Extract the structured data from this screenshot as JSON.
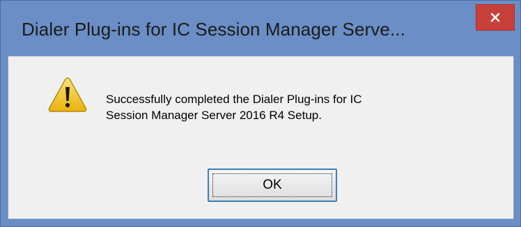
{
  "dialog": {
    "title": "Dialer Plug-ins for IC Session Manager Serve...",
    "close_icon": "close-icon",
    "icon": "warning-icon",
    "message_lines": [
      "Successfully completed the Dialer Plug-ins for IC",
      "Session Manager Server 2016 R4 Setup."
    ],
    "ok_label": "OK"
  },
  "colors": {
    "frame": "#6a8ec5",
    "close_button": "#c7413a",
    "client_background": "#f0f0f0",
    "warning_yellow": "#f2c417",
    "button_focus_border": "#3c7fb1"
  }
}
